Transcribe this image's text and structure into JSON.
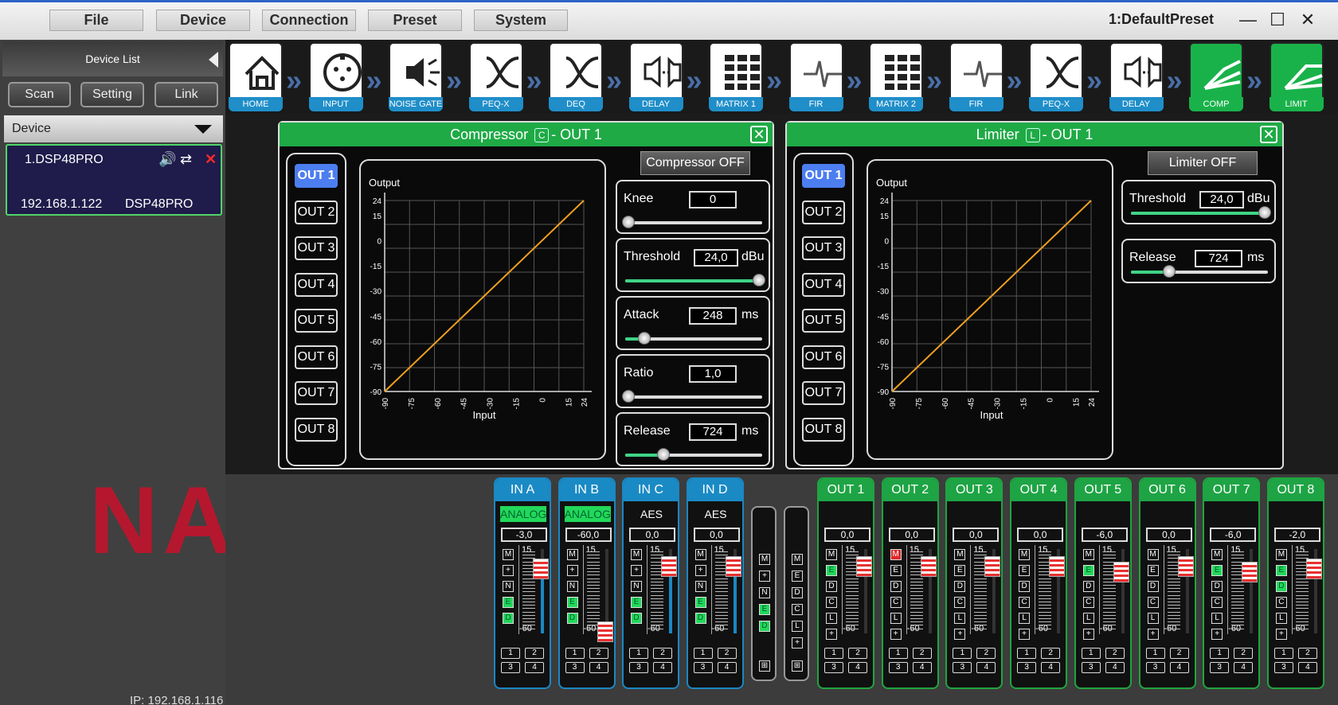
{
  "menu": {
    "file": "File",
    "device": "Device",
    "connection": "Connection",
    "preset": "Preset",
    "system": "System"
  },
  "window": {
    "preset_name": "1:DefaultPreset",
    "minimize": "—",
    "maximize": "☐",
    "close": "✕"
  },
  "left": {
    "device_list_title": "Device List",
    "scan": "Scan",
    "setting": "Setting",
    "link": "Link",
    "device_dropdown": "Device",
    "device": {
      "name": "1.DSP48PRO",
      "ip": "192.168.1.122",
      "model": "DSP48PRO"
    },
    "logo_text": "NAG",
    "ip_status": "IP: 192.168.1.116"
  },
  "toolbar": [
    {
      "label": "HOME",
      "icon": "home-icon"
    },
    {
      "label": "INPUT",
      "icon": "xlr-input-icon"
    },
    {
      "label": "NOISE GATE",
      "icon": "speaker-gate-icon"
    },
    {
      "label": "PEQ-X",
      "icon": "crossover-icon"
    },
    {
      "label": "DEQ",
      "icon": "crossover-icon"
    },
    {
      "label": "DELAY",
      "icon": "delay-speaker-icon"
    },
    {
      "label": "MATRIX 1",
      "icon": "matrix-icon"
    },
    {
      "label": "FIR",
      "icon": "fir-icon"
    },
    {
      "label": "MATRIX 2",
      "icon": "matrix-icon"
    },
    {
      "label": "FIR",
      "icon": "fir-icon"
    },
    {
      "label": "PEQ-X",
      "icon": "crossover-icon"
    },
    {
      "label": "DELAY",
      "icon": "delay-speaker-icon"
    },
    {
      "label": "COMP",
      "icon": "compressor-icon"
    },
    {
      "label": "LIMIT",
      "icon": "limiter-icon"
    }
  ],
  "compressor": {
    "title": "Compressor",
    "badge": "C",
    "suffix": "- OUT 1",
    "off_button": "Compressor OFF",
    "outputs": [
      "OUT 1",
      "OUT 2",
      "OUT 3",
      "OUT 4",
      "OUT 5",
      "OUT 6",
      "OUT 7",
      "OUT 8"
    ],
    "selected": 0,
    "graph": {
      "ylabel": "Output",
      "xlabel": "Input",
      "yticks": [
        "24",
        "15",
        "0",
        "-15",
        "-30",
        "-45",
        "-60",
        "-75",
        "-90"
      ],
      "xticks": [
        "-90",
        "-75",
        "-60",
        "-45",
        "-30",
        "-15",
        "0",
        "15",
        "24"
      ]
    },
    "params": [
      {
        "label": "Knee",
        "value": "0",
        "unit": "",
        "level": 0.0
      },
      {
        "label": "Threshold",
        "value": "24,0",
        "unit": "dBu",
        "level": 1.0
      },
      {
        "label": "Attack",
        "value": "248",
        "unit": "ms",
        "level": 0.12
      },
      {
        "label": "Ratio",
        "value": "1,0",
        "unit": "",
        "level": 0.0
      },
      {
        "label": "Release",
        "value": "724",
        "unit": "ms",
        "level": 0.27
      }
    ]
  },
  "limiter": {
    "title": "Limiter",
    "badge": "L",
    "suffix": "- OUT 1",
    "off_button": "Limiter OFF",
    "outputs": [
      "OUT 1",
      "OUT 2",
      "OUT 3",
      "OUT 4",
      "OUT 5",
      "OUT 6",
      "OUT 7",
      "OUT 8"
    ],
    "selected": 0,
    "graph": {
      "ylabel": "Output",
      "xlabel": "Input",
      "yticks": [
        "24",
        "15",
        "0",
        "-15",
        "-30",
        "-45",
        "-60",
        "-75",
        "-90"
      ],
      "xticks": [
        "-90",
        "-75",
        "-60",
        "-45",
        "-30",
        "-15",
        "0",
        "15",
        "24"
      ]
    },
    "params": [
      {
        "label": "Threshold",
        "value": "24,0",
        "unit": "dBu",
        "level": 1.0
      },
      {
        "label": "Release",
        "value": "724",
        "unit": "ms",
        "level": 0.27
      }
    ]
  },
  "mixer": {
    "scale_top": "15",
    "scale_bottom": "-60",
    "inputs": [
      {
        "name": "IN A",
        "source": "ANALOG",
        "source_green": true,
        "gain": "-3,0",
        "level": 0.87,
        "keys": [
          "M",
          "+",
          "N",
          "E",
          "D"
        ],
        "on": [
          "E",
          "D"
        ]
      },
      {
        "name": "IN B",
        "source": "ANALOG",
        "source_green": true,
        "gain": "-60,0",
        "level": 0.05,
        "keys": [
          "M",
          "+",
          "N",
          "E",
          "D"
        ],
        "on": [
          "E",
          "D"
        ]
      },
      {
        "name": "IN C",
        "source": "AES",
        "source_green": false,
        "gain": "0,0",
        "level": 0.91,
        "keys": [
          "M",
          "+",
          "N",
          "E",
          "D"
        ],
        "on": [
          "E",
          "D"
        ]
      },
      {
        "name": "IN D",
        "source": "AES",
        "source_green": false,
        "gain": "0,0",
        "level": 0.91,
        "keys": [
          "M",
          "+",
          "N",
          "E",
          "D"
        ],
        "on": [
          "E",
          "D"
        ]
      }
    ],
    "mini1": {
      "keys": [
        "M",
        "+",
        "N",
        "E",
        "D"
      ],
      "on": [
        "E",
        "D"
      ]
    },
    "mini2": {
      "keys": [
        "M",
        "E",
        "D",
        "C",
        "L",
        "+"
      ],
      "on": []
    },
    "outputs": [
      {
        "name": "OUT 1",
        "gain": "0,0",
        "level": 0.91,
        "keys": [
          "M",
          "E",
          "D",
          "C",
          "L",
          "+"
        ],
        "on": [
          "E"
        ],
        "red": []
      },
      {
        "name": "OUT 2",
        "gain": "0,0",
        "level": 0.91,
        "keys": [
          "M",
          "E",
          "D",
          "C",
          "L",
          "+"
        ],
        "on": [],
        "red": [
          "M"
        ]
      },
      {
        "name": "OUT 3",
        "gain": "0,0",
        "level": 0.91,
        "keys": [
          "M",
          "E",
          "D",
          "C",
          "L",
          "+"
        ],
        "on": [],
        "red": []
      },
      {
        "name": "OUT 4",
        "gain": "0,0",
        "level": 0.91,
        "keys": [
          "M",
          "E",
          "D",
          "C",
          "L",
          "+"
        ],
        "on": [],
        "red": []
      },
      {
        "name": "OUT 5",
        "gain": "-6,0",
        "level": 0.83,
        "keys": [
          "M",
          "E",
          "D",
          "C",
          "L",
          "+"
        ],
        "on": [
          "E"
        ],
        "red": []
      },
      {
        "name": "OUT 6",
        "gain": "0,0",
        "level": 0.91,
        "keys": [
          "M",
          "E",
          "D",
          "C",
          "L",
          "+"
        ],
        "on": [],
        "red": []
      },
      {
        "name": "OUT 7",
        "gain": "-6,0",
        "level": 0.83,
        "keys": [
          "M",
          "E",
          "D",
          "C",
          "L",
          "+"
        ],
        "on": [
          "E"
        ],
        "red": []
      },
      {
        "name": "OUT 8",
        "gain": "-2,0",
        "level": 0.88,
        "keys": [
          "M",
          "E",
          "D",
          "C",
          "L",
          "+"
        ],
        "on": [
          "E",
          "D"
        ],
        "red": []
      }
    ],
    "route_buttons": [
      "1",
      "2",
      "3",
      "4"
    ]
  },
  "colors": {
    "accent_blue": "#1f8ec9",
    "green": "#1faa46",
    "curve": "#f0a020",
    "logo_red": "#b5182e"
  }
}
